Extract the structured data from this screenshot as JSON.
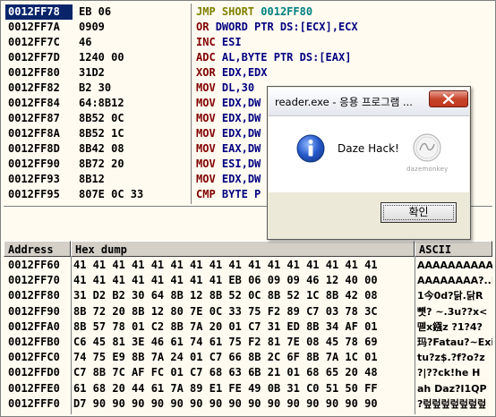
{
  "disassembly": [
    {
      "addr": "0012FF78",
      "hex": "EB 06",
      "mnem": "JMP SHORT",
      "rest": "0012FF80",
      "kind": "jmp"
    },
    {
      "addr": "0012FF7A",
      "hex": "0909",
      "mnem": "OR",
      "rest": "DWORD PTR DS:[ECX],ECX",
      "kind": "op"
    },
    {
      "addr": "0012FF7C",
      "hex": "46",
      "mnem": "INC",
      "rest": "ESI",
      "kind": "op"
    },
    {
      "addr": "0012FF7D",
      "hex": "1240 00",
      "mnem": "ADC",
      "rest": "AL,BYTE PTR DS:[EAX]",
      "kind": "op"
    },
    {
      "addr": "0012FF80",
      "hex": "31D2",
      "mnem": "XOR",
      "rest": "EDX,EDX",
      "kind": "op"
    },
    {
      "addr": "0012FF82",
      "hex": "B2 30",
      "mnem": "MOV",
      "rest": "DL,30",
      "kind": "op"
    },
    {
      "addr": "0012FF84",
      "hex": "64:8B12",
      "mnem": "MOV",
      "rest": "EDX,DW",
      "kind": "op"
    },
    {
      "addr": "0012FF87",
      "hex": "8B52 0C",
      "mnem": "MOV",
      "rest": "EDX,DW",
      "kind": "op"
    },
    {
      "addr": "0012FF8A",
      "hex": "8B52 1C",
      "mnem": "MOV",
      "rest": "EDX,DW",
      "kind": "op"
    },
    {
      "addr": "0012FF8D",
      "hex": "8B42 08",
      "mnem": "MOV",
      "rest": "EAX,DW",
      "kind": "op"
    },
    {
      "addr": "0012FF90",
      "hex": "8B72 20",
      "mnem": "MOV",
      "rest": "ESI,DW",
      "kind": "op"
    },
    {
      "addr": "0012FF93",
      "hex": "8B12",
      "mnem": "MOV",
      "rest": "EDX,DW",
      "kind": "op"
    },
    {
      "addr": "0012FF95",
      "hex": "807E 0C 33",
      "mnem": "CMP",
      "rest": "BYTE P",
      "kind": "op"
    }
  ],
  "dump_headers": {
    "address": "Address",
    "hex": "Hex dump",
    "ascii": "ASCII"
  },
  "dump": [
    {
      "addr": "0012FF60",
      "bytes": "41 41 41 41 41 41 41 41 41 41 41 41 41 41 41 41",
      "ascii": "AAAAAAAAAAAAAAAA"
    },
    {
      "addr": "0012FF70",
      "bytes": "41 41 41 41 41 41 41 41 EB 06 09 09 46 12 40 00",
      "ascii": "AAAAAAAA?..F@."
    },
    {
      "addr": "0012FF80",
      "bytes": "31 D2 B2 30 64 8B 12 8B 52 0C 8B 52 1C 8B 42 08",
      "ascii": "1今0d?닭.닭R"
    },
    {
      "addr": "0012FF90",
      "bytes": "8B 72 20 8B 12 80 7E 0C 33 75 F2 89 C7 03 78 3C",
      "ascii": "뻇? ~.3u??x<"
    },
    {
      "addr": "0012FFA0",
      "bytes": "8B 57 78 01 C2 8B 7A 20 01 C7 31 ED 8B 34 AF 01",
      "ascii": "뗻x鏹z ?1?4?"
    },
    {
      "addr": "0012FFB0",
      "bytes": "C6 45 81 3E 46 61 74 61 75 F2 81 7E 08 45 78 69",
      "ascii": "玛?Fatau?~Exi"
    },
    {
      "addr": "0012FFC0",
      "bytes": "74 75 E9 8B 7A 24 01 C7 66 8B 2C 6F 8B 7A 1C 01",
      "ascii": "tu?z$.?f?o?z"
    },
    {
      "addr": "0012FFD0",
      "bytes": "C7 8B 7C AF FC 01 C7 68 63 6B 21 01 68 65 20 48",
      "ascii": "?|??ck!he H"
    },
    {
      "addr": "0012FFE0",
      "bytes": "61 68 20 44 61 7A 89 E1 FE 49 0B 31 C0 51 50 FF",
      "ascii": "ah Daz?I1QP"
    },
    {
      "addr": "0012FFF0",
      "bytes": "D7 90 90 90 90 90 90 90 90 90 90 90 90 90 90 90",
      "ascii": "?렆렆렆렆렆렆렆"
    }
  ],
  "dialog": {
    "title": "reader.exe - 응용 프로그램 ...",
    "message": "Daze Hack!",
    "ok_label": "확인",
    "logo_text": "dazemonkey",
    "icon": "info-icon"
  },
  "colors": {
    "selection": "#0a246a",
    "mnemonic": "#800000",
    "jump": "#808000",
    "jump_target": "#008080",
    "operand": "#000080",
    "background": "#fffbf0"
  }
}
